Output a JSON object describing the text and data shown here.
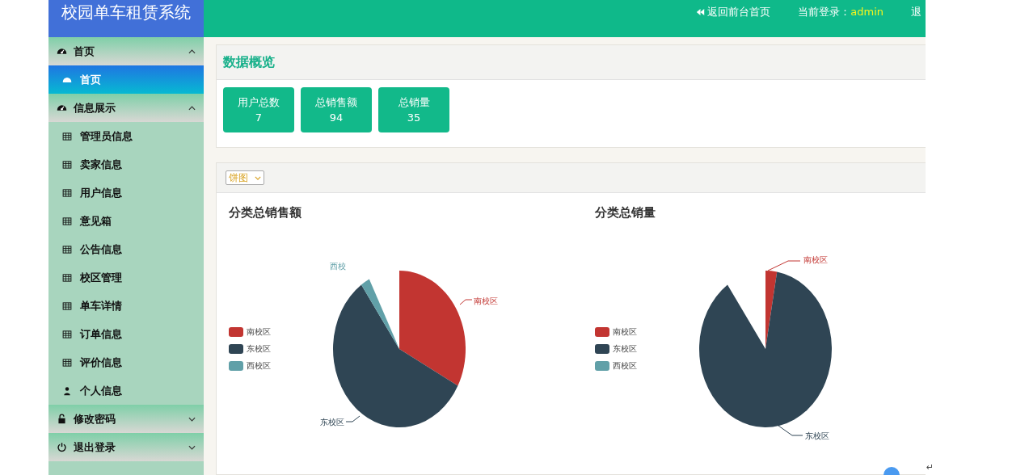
{
  "header": {
    "title": "校园单车租赁系统",
    "back_link": "返回前台首页",
    "login_label": "当前登录：",
    "user": "admin",
    "logout": "退"
  },
  "sidebar": [
    {
      "kind": "group",
      "label": "首页",
      "expanded": true,
      "children": [
        {
          "label": "首页",
          "selected": true
        }
      ]
    },
    {
      "kind": "group",
      "label": "信息展示",
      "expanded": true,
      "children": [
        {
          "label": "管理员信息",
          "selected": false
        },
        {
          "label": "卖家信息",
          "selected": false
        },
        {
          "label": "用户信息",
          "selected": false
        },
        {
          "label": "意见箱",
          "selected": false
        },
        {
          "label": "公告信息",
          "selected": false
        },
        {
          "label": "校区管理",
          "selected": false
        },
        {
          "label": "单车详情",
          "selected": false
        },
        {
          "label": "订单信息",
          "selected": false
        },
        {
          "label": "评价信息",
          "selected": false
        },
        {
          "label": "个人信息",
          "selected": false
        }
      ]
    },
    {
      "kind": "group",
      "label": "修改密码",
      "expanded": false
    },
    {
      "kind": "group",
      "label": "退出登录",
      "expanded": false
    }
  ],
  "overview": {
    "title": "数据概览",
    "stats": [
      {
        "label": "用户总数",
        "value": "7"
      },
      {
        "label": "总销售额",
        "value": "94"
      },
      {
        "label": "总销量",
        "value": "35"
      }
    ]
  },
  "chart_panel": {
    "select": "饼图",
    "charts": [
      {
        "title": "分类总销售额",
        "legend": [
          {
            "label": "南校区",
            "color": "#c23531"
          },
          {
            "label": "东校区",
            "color": "#2f4554"
          },
          {
            "label": "西校区",
            "color": "#61a0a8"
          }
        ],
        "slice_labels": [
          "南校区",
          "东校区",
          "西校"
        ]
      },
      {
        "title": "分类总销量",
        "legend": [
          {
            "label": "南校区",
            "color": "#c23531"
          },
          {
            "label": "东校区",
            "color": "#2f4554"
          },
          {
            "label": "西校区",
            "color": "#61a0a8"
          }
        ],
        "slice_labels": [
          "南校区",
          "东校区"
        ]
      }
    ]
  },
  "return_mark": "↵"
}
